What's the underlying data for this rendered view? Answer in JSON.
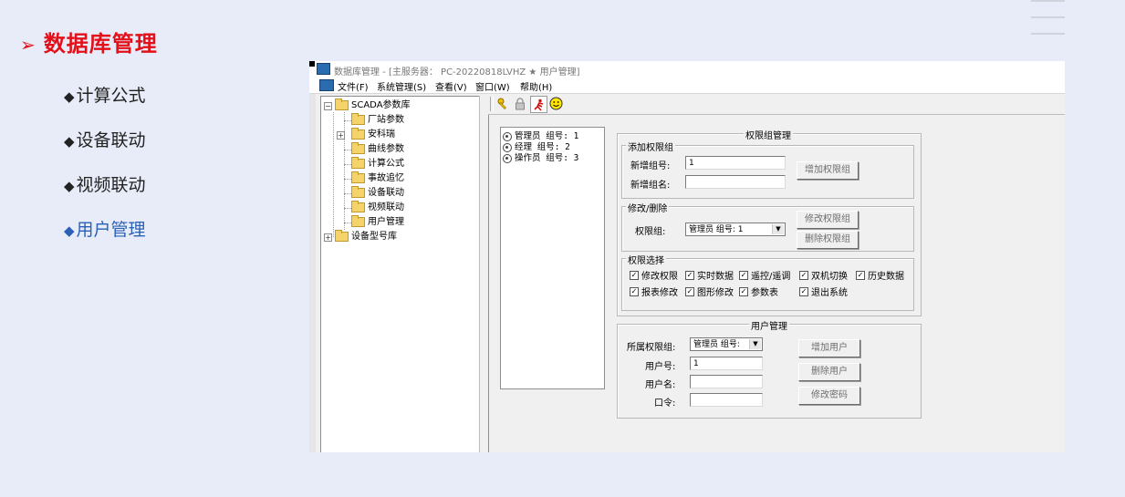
{
  "slide": {
    "title": "数据库管理",
    "nav_items": [
      {
        "label": "计算公式"
      },
      {
        "label": "设备联动"
      },
      {
        "label": "视频联动"
      },
      {
        "label": "用户管理"
      }
    ],
    "active_color": "#2a61b6",
    "title_color": "#e3101a"
  },
  "window": {
    "title": "数据库管理 - [主服务器：  PC-20220818LVHZ ★ 用户管理]",
    "menu": [
      "文件(F)",
      "系统管理(S)",
      "查看(V)",
      "窗口(W)",
      "帮助(H)"
    ]
  },
  "tree": {
    "root": "SCADA参数库",
    "children": [
      "厂站参数",
      "安科瑞",
      "曲线参数",
      "计算公式",
      "事故追忆",
      "设备联动",
      "视频联动",
      "用户管理"
    ],
    "second_root": "设备型号库"
  },
  "toolbar": {
    "icons": [
      "key-icon",
      "lock-icon",
      "running-man-icon",
      "smiley-icon"
    ]
  },
  "group_list": {
    "items": [
      "管理员 组号: 1",
      "经理 组号: 2",
      "操作员 组号: 3"
    ]
  },
  "perm_group_mgmt": {
    "title": "权限组管理",
    "add": {
      "title": "添加权限组",
      "new_id_label": "新增组号:",
      "new_id_value": "1",
      "new_name_label": "新增组名:",
      "new_name_value": "",
      "add_button": "增加权限组"
    },
    "modify": {
      "title": "修改/删除",
      "group_label": "权限组:",
      "group_value": "管理员 组号: 1",
      "modify_button": "修改权限组",
      "delete_button": "删除权限组"
    },
    "perms": {
      "title": "权限选择",
      "items": [
        "修改权限",
        "实时数据",
        "遥控/遥调",
        "双机切换",
        "历史数据",
        "报表修改",
        "图形修改",
        "参数表",
        "退出系统"
      ]
    }
  },
  "user_mgmt": {
    "title": "用户管理",
    "group_label": "所属权限组:",
    "group_value": "管理员 组号:",
    "user_id_label": "用户号:",
    "user_id_value": "1",
    "user_name_label": "用户名:",
    "user_name_value": "",
    "password_label": "口令:",
    "password_value": "",
    "add_button": "增加用户",
    "delete_button": "删除用户",
    "change_pwd_button": "修改密码"
  }
}
